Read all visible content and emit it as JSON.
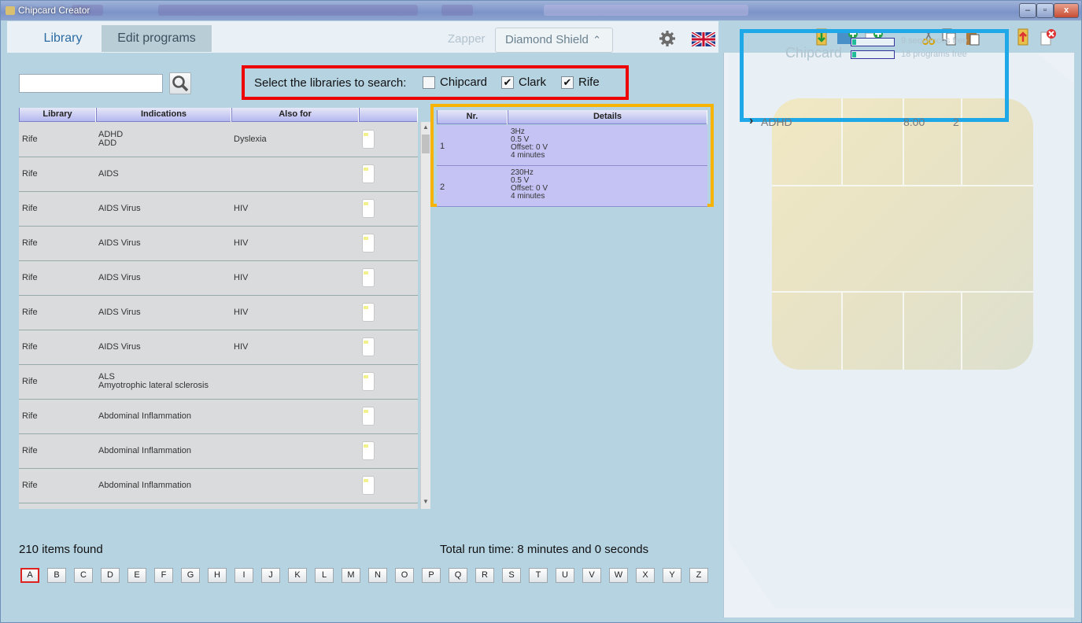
{
  "window": {
    "title": "Chipcard Creator"
  },
  "tabs": {
    "library": "Library",
    "edit_programs": "Edit programs"
  },
  "zapper": {
    "label": "Zapper",
    "value": "Diamond Shield"
  },
  "search": {
    "value": "",
    "button_icon": "magnifier-icon"
  },
  "libraries": {
    "label": "Select the libraries to search:",
    "options": [
      {
        "label": "Chipcard",
        "checked": false,
        "mark": ""
      },
      {
        "label": "Clark",
        "checked": true,
        "mark": "✔"
      },
      {
        "label": "Rife",
        "checked": true,
        "mark": "✔"
      }
    ]
  },
  "list": {
    "headers": [
      "Library",
      "Indications",
      "Also for",
      ""
    ],
    "rows": [
      {
        "library": "Rife",
        "indications": [
          "ADHD",
          "ADD"
        ],
        "also_for": "Dyslexia"
      },
      {
        "library": "Rife",
        "indications": [
          "AIDS"
        ],
        "also_for": ""
      },
      {
        "library": "Rife",
        "indications": [
          "AIDS Virus"
        ],
        "also_for": "HIV"
      },
      {
        "library": "Rife",
        "indications": [
          "AIDS Virus"
        ],
        "also_for": "HIV"
      },
      {
        "library": "Rife",
        "indications": [
          "AIDS Virus"
        ],
        "also_for": "HIV"
      },
      {
        "library": "Rife",
        "indications": [
          "AIDS Virus"
        ],
        "also_for": "HIV"
      },
      {
        "library": "Rife",
        "indications": [
          "AIDS Virus"
        ],
        "also_for": "HIV"
      },
      {
        "library": "Rife",
        "indications": [
          "ALS",
          "Amyotrophic lateral sclerosis"
        ],
        "also_for": ""
      },
      {
        "library": "Rife",
        "indications": [
          "Abdominal Inflammation"
        ],
        "also_for": ""
      },
      {
        "library": "Rife",
        "indications": [
          "Abdominal Inflammation"
        ],
        "also_for": ""
      },
      {
        "library": "Rife",
        "indications": [
          "Abdominal Inflammation"
        ],
        "also_for": ""
      }
    ]
  },
  "details": {
    "headers": [
      "Nr.",
      "Details"
    ],
    "rows": [
      {
        "nr": "1",
        "lines": [
          "3Hz",
          "0.5 V",
          "Offset: 0 V",
          "4 minutes"
        ]
      },
      {
        "nr": "2",
        "lines": [
          "230Hz",
          "0.5 V",
          "Offset: 0 V",
          "4 minutes"
        ]
      }
    ]
  },
  "status": {
    "found": "210 items found",
    "runtime": "Total run time: 8 minutes and 0 seconds"
  },
  "alphabet": [
    "A",
    "B",
    "C",
    "D",
    "E",
    "F",
    "G",
    "H",
    "I",
    "J",
    "K",
    "L",
    "M",
    "N",
    "O",
    "P",
    "Q",
    "R",
    "S",
    "T",
    "U",
    "V",
    "W",
    "X",
    "Y",
    "Z"
  ],
  "alphabet_active": "A",
  "chipcard": {
    "label": "Chipcard",
    "sequences_free": "9 sequences free",
    "programs_free": "18 programs free",
    "sequence": {
      "arrow": "›",
      "name": "ADHD",
      "time": "8:00",
      "count": "2"
    }
  },
  "toolbar_icons": [
    "import-icon",
    "new-folder-icon",
    "new-program-icon",
    "cut-icon",
    "copy-icon",
    "paste-icon",
    "upload-icon",
    "delete-icon"
  ],
  "window_controls": {
    "minimize": "–",
    "maximize": "▫",
    "close": "x"
  },
  "colors": {
    "background": "#b6d3e2",
    "red_highlight": "#e00000",
    "orange_highlight": "#f6b300",
    "blue_highlight": "#1ea8e8",
    "row_selected": "#c5c3f4"
  }
}
